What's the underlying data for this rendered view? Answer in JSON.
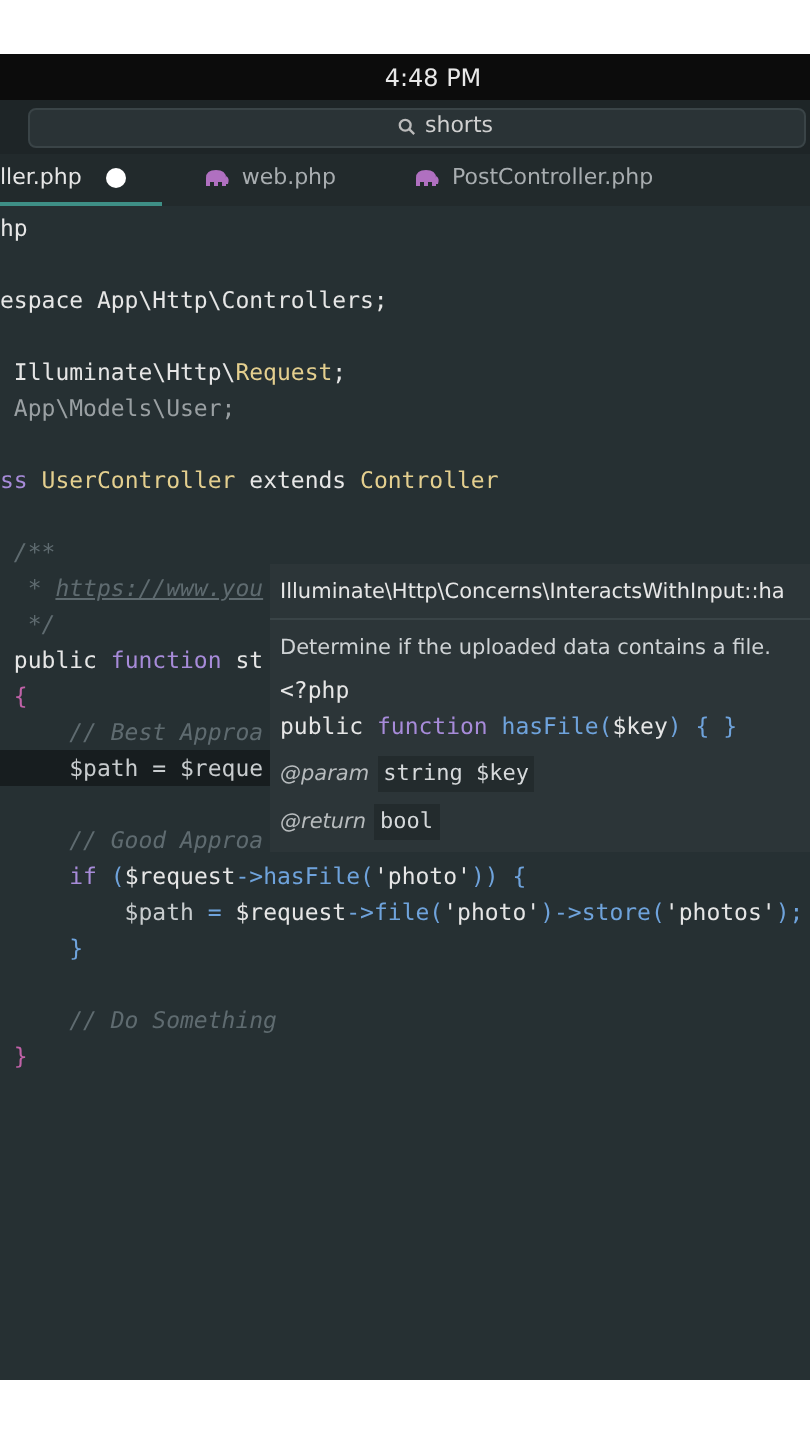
{
  "status_bar": {
    "time": "4:48 PM"
  },
  "search": {
    "value": "shorts"
  },
  "tabs": [
    {
      "label": "ller.php",
      "selected": true,
      "modified": true,
      "icon": false
    },
    {
      "label": "web.php",
      "selected": false,
      "modified": false,
      "icon": true
    },
    {
      "label": "PostController.php",
      "selected": false,
      "modified": false,
      "icon": true
    }
  ],
  "code_lines": [
    {
      "current": false,
      "tokens": [
        {
          "kind": "plain",
          "text": "hp"
        }
      ]
    },
    {
      "current": false
    },
    {
      "current": false,
      "tokens": [
        {
          "kind": "plain",
          "text": "espace App\\Http\\Controllers;"
        }
      ]
    },
    {
      "current": false
    },
    {
      "current": false,
      "tokens": [
        {
          "kind": "plain",
          "text": " Illuminate\\Http\\"
        },
        {
          "kind": "class",
          "text": "Request"
        },
        {
          "kind": "plain",
          "text": ";"
        }
      ]
    },
    {
      "current": false,
      "tokens": [
        {
          "kind": "dim",
          "text": " App\\Models\\User;"
        }
      ]
    },
    {
      "current": false
    },
    {
      "current": false,
      "tokens": [
        {
          "kind": "keyword",
          "text": "ss"
        },
        {
          "kind": "class",
          "text": " UserController"
        },
        {
          "kind": "plain",
          "text": " extends "
        },
        {
          "kind": "class",
          "text": "Controller"
        }
      ]
    },
    {
      "current": false
    },
    {
      "current": false,
      "tokens": [
        {
          "kind": "comment",
          "text": " /**"
        }
      ]
    },
    {
      "current": false,
      "tokens": [
        {
          "kind": "comment",
          "text": "  * "
        },
        {
          "kind": "link",
          "text": "https://www.you"
        }
      ]
    },
    {
      "current": false,
      "tokens": [
        {
          "kind": "comment",
          "text": "  */"
        }
      ]
    },
    {
      "current": false,
      "tokens": [
        {
          "kind": "plain",
          "text": " public "
        },
        {
          "kind": "keyword",
          "text": "function"
        },
        {
          "kind": "plain",
          "text": " st"
        }
      ]
    },
    {
      "current": false,
      "tokens": [
        {
          "kind": "brace",
          "text": " {"
        }
      ]
    },
    {
      "current": false,
      "tokens": [
        {
          "kind": "comment",
          "text": "     // Best Approa"
        }
      ]
    },
    {
      "current": true,
      "tokens": [
        {
          "kind": "var",
          "text": "     $path = $reque"
        }
      ]
    },
    {
      "current": false
    },
    {
      "current": false,
      "tokens": [
        {
          "kind": "comment",
          "text": "     // Good Approa"
        }
      ]
    },
    {
      "current": false,
      "tokens": [
        {
          "kind": "keyword",
          "text": "     if"
        },
        {
          "kind": "punct",
          "text": " ("
        },
        {
          "kind": "plain",
          "text": "$request"
        },
        {
          "kind": "punct",
          "text": "->"
        },
        {
          "kind": "func",
          "text": "hasFile"
        },
        {
          "kind": "punct",
          "text": "("
        },
        {
          "kind": "string",
          "text": "'photo'"
        },
        {
          "kind": "punct",
          "text": ")) {"
        }
      ]
    },
    {
      "current": false,
      "tokens": [
        {
          "kind": "var",
          "text": "         $path"
        },
        {
          "kind": "punct",
          "text": " = "
        },
        {
          "kind": "plain",
          "text": "$request"
        },
        {
          "kind": "punct",
          "text": "->"
        },
        {
          "kind": "func",
          "text": "file"
        },
        {
          "kind": "punct",
          "text": "("
        },
        {
          "kind": "string",
          "text": "'photo'"
        },
        {
          "kind": "punct",
          "text": ")->"
        },
        {
          "kind": "func",
          "text": "store"
        },
        {
          "kind": "punct",
          "text": "("
        },
        {
          "kind": "string",
          "text": "'photos'"
        },
        {
          "kind": "punct",
          "text": ");"
        }
      ]
    },
    {
      "current": false,
      "tokens": [
        {
          "kind": "punct",
          "text": "     }"
        }
      ]
    },
    {
      "current": false
    },
    {
      "current": false,
      "tokens": [
        {
          "kind": "comment",
          "text": "     // Do Something"
        }
      ]
    },
    {
      "current": false,
      "tokens": [
        {
          "kind": "brace",
          "text": " }"
        }
      ]
    }
  ],
  "hover": {
    "title": "Illuminate\\Http\\Concerns\\InteractsWithInput::ha",
    "description": "Determine if the uploaded data contains a file.",
    "code": [
      "<?php"
    ],
    "signature": [
      {
        "kind": "plain",
        "text": "public "
      },
      {
        "kind": "keyword",
        "text": "function"
      },
      {
        "kind": "func",
        "text": " hasFile"
      },
      {
        "kind": "punct",
        "text": "("
      },
      {
        "kind": "plain",
        "text": "$key"
      },
      {
        "kind": "punct",
        "text": ") { }"
      }
    ],
    "tags": [
      {
        "tag": "@param",
        "value": "string $key"
      },
      {
        "tag": "@return",
        "value": "bool"
      }
    ]
  }
}
